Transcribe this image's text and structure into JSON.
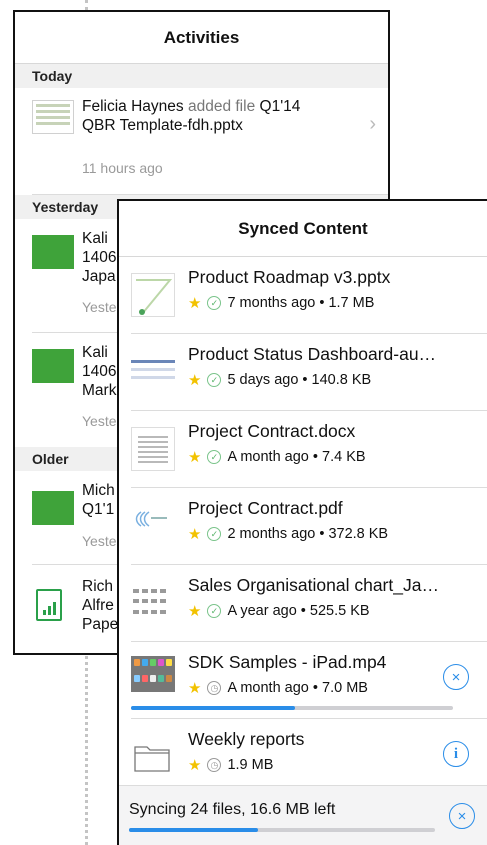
{
  "activities": {
    "title": "Activities",
    "sections": {
      "today": "Today",
      "yesterday": "Yesterday",
      "older": "Older"
    },
    "items": [
      {
        "actor": "Felicia Haynes",
        "verb": "added file",
        "object": "Q1'14",
        "line2": "QBR Template-fdh.pptx",
        "time": "11 hours ago"
      },
      {
        "line1": "Kali",
        "line2": "1406",
        "line3": "Japa",
        "time": "Yeste"
      },
      {
        "line1": "Kali",
        "line2": "1406",
        "line3": "Mark",
        "time": "Yeste"
      },
      {
        "line1": "Mich",
        "line2": "Q1'1",
        "time": "Yeste"
      },
      {
        "line1": "Rich",
        "line2": "Alfre",
        "line3": "Pape"
      }
    ]
  },
  "synced": {
    "title": "Synced Content",
    "items": [
      {
        "name": "Product Roadmap v3.pptx",
        "meta": "7 months ago • 1.7 MB",
        "status": "synced"
      },
      {
        "name": "Product Status Dashboard-au…",
        "meta": "5 days ago • 140.8 KB",
        "status": "synced"
      },
      {
        "name": "Project Contract.docx",
        "meta": "A month ago • 7.4 KB",
        "status": "synced"
      },
      {
        "name": "Project Contract.pdf",
        "meta": "2 months ago • 372.8 KB",
        "status": "synced"
      },
      {
        "name": "Sales Organisational chart_Ja…",
        "meta": "A year ago • 525.5 KB",
        "status": "synced"
      },
      {
        "name": "SDK Samples - iPad.mp4",
        "meta": "A month ago • 7.0 MB",
        "status": "pending",
        "progress": 0.51
      },
      {
        "name": "Weekly reports",
        "meta": "1.9 MB",
        "status": "pending"
      }
    ],
    "footer": {
      "text": "Syncing 24 files, 16.6 MB left",
      "progress": 0.42
    }
  },
  "colors": {
    "accent": "#2a8de8",
    "star": "#f2c200",
    "synced_check": "#5bb56c"
  },
  "icons": {
    "star": "★",
    "check": "✓",
    "clock": "◷",
    "close": "×",
    "info": "i",
    "chevron": "›"
  }
}
